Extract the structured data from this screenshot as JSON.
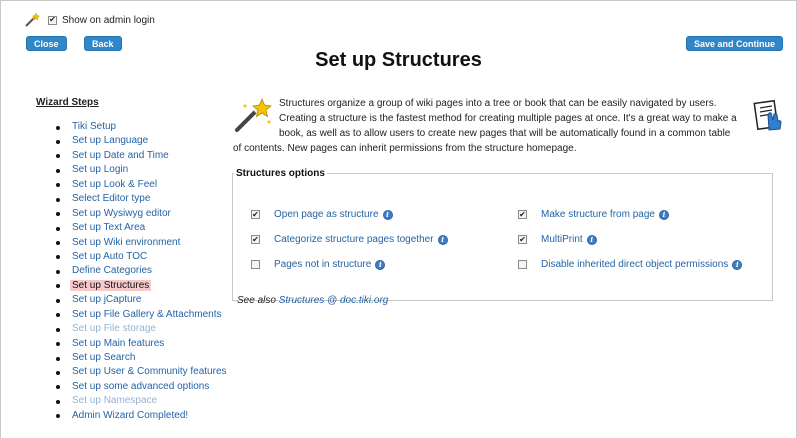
{
  "top": {
    "show_admin_login_label": "Show on admin login",
    "show_admin_login_checked": true
  },
  "buttons": {
    "close": "Close",
    "back": "Back",
    "save_continue": "Save and Continue"
  },
  "page_title": "Set up Structures",
  "wizard": {
    "title": "Wizard Steps",
    "steps": [
      {
        "label": "Tiki Setup",
        "state": "link"
      },
      {
        "label": "Set up Language",
        "state": "link"
      },
      {
        "label": "Set up Date and Time",
        "state": "link"
      },
      {
        "label": "Set up Login",
        "state": "link"
      },
      {
        "label": "Set up Look & Feel",
        "state": "link"
      },
      {
        "label": "Select Editor type",
        "state": "link"
      },
      {
        "label": "Set up Wysiwyg editor",
        "state": "link"
      },
      {
        "label": "Set up Text Area",
        "state": "link"
      },
      {
        "label": "Set up Wiki environment",
        "state": "link"
      },
      {
        "label": "Set up Auto TOC",
        "state": "link"
      },
      {
        "label": "Define Categories",
        "state": "link"
      },
      {
        "label": "Set up Structures",
        "state": "current"
      },
      {
        "label": "Set up jCapture",
        "state": "link"
      },
      {
        "label": "Set up File Gallery & Attachments",
        "state": "link"
      },
      {
        "label": "Set up File storage",
        "state": "disabled"
      },
      {
        "label": "Set up Main features",
        "state": "link"
      },
      {
        "label": "Set up Search",
        "state": "link"
      },
      {
        "label": "Set up User & Community features",
        "state": "link"
      },
      {
        "label": "Set up some advanced options",
        "state": "link"
      },
      {
        "label": "Set up Namespace",
        "state": "disabled"
      },
      {
        "label": "Admin Wizard Completed!",
        "state": "link"
      }
    ]
  },
  "intro_text": "Structures organize a group of wiki pages into a tree or book that can be easily navigated by users. Creating a structure is the fastest method for creating multiple pages at once. It's a great way to make a book, as well as to allow users to create new pages that will be automatically found in a common table of contents. New pages can inherit permissions from the structure homepage.",
  "options": {
    "legend": "Structures options",
    "items": [
      {
        "label": "Open page as structure",
        "checked": true
      },
      {
        "label": "Categorize structure pages together",
        "checked": true
      },
      {
        "label": "Pages not in structure",
        "checked": false
      },
      {
        "label": "Make structure from page",
        "checked": true
      },
      {
        "label": "MultiPrint",
        "checked": true
      },
      {
        "label": "Disable inherited direct object permissions",
        "checked": false
      }
    ],
    "see_also_prefix": "See also ",
    "see_also_link": "Structures @ doc.tiki.org"
  },
  "icons": {
    "wand": "magic-wand-icon",
    "doc": "documentation-icon",
    "info": "info-icon"
  },
  "colors": {
    "button": "#2f86c9",
    "link": "#2463a6",
    "disabled_link": "#93b4d4",
    "current_highlight": "#f6c8cc"
  }
}
